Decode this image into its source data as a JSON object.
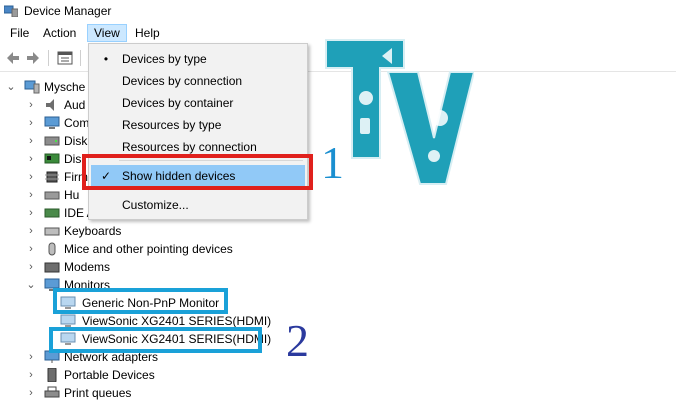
{
  "window": {
    "title": "Device Manager"
  },
  "menu": {
    "file": "File",
    "action": "Action",
    "view": "View",
    "help": "Help"
  },
  "view_menu": {
    "items": [
      {
        "label": "Devices by type",
        "mark": "•"
      },
      {
        "label": "Devices by connection",
        "mark": ""
      },
      {
        "label": "Devices by container",
        "mark": ""
      },
      {
        "label": "Resources by type",
        "mark": ""
      },
      {
        "label": "Resources by connection",
        "mark": ""
      },
      {
        "label": "Show hidden devices",
        "mark": "✓"
      },
      {
        "label": "Customize...",
        "mark": ""
      }
    ]
  },
  "tree": {
    "root": "Mysche",
    "rows": [
      {
        "label": "Aud",
        "icon": "speaker-icon"
      },
      {
        "label": "Com",
        "icon": "computer-icon"
      },
      {
        "label": "Disk",
        "icon": "disk-drive-icon"
      },
      {
        "label": "Dis",
        "icon": "display-adapter-icon"
      },
      {
        "label": "Firm",
        "icon": "firmware-icon"
      },
      {
        "label": "Hu",
        "icon": "hid-icon"
      },
      {
        "label": "IDE A",
        "icon": "ide-controller-icon"
      },
      {
        "label": "Keyboards",
        "icon": "keyboard-icon"
      },
      {
        "label": "Mice and other pointing devices",
        "icon": "mouse-icon"
      },
      {
        "label": "Modems",
        "icon": "modem-icon"
      },
      {
        "label": "Monitors",
        "icon": "monitor-icon"
      },
      {
        "label": "Generic Non-PnP Monitor",
        "icon": "monitor-icon"
      },
      {
        "label": "ViewSonic XG2401 SERIES(HDMI)",
        "icon": "monitor-icon"
      },
      {
        "label": "ViewSonic XG2401 SERIES(HDMI)",
        "icon": "monitor-icon"
      },
      {
        "label": "Network adapters",
        "icon": "network-icon"
      },
      {
        "label": "Portable Devices",
        "icon": "portable-device-icon"
      },
      {
        "label": "Print queues",
        "icon": "printer-icon"
      }
    ]
  },
  "annotations": {
    "callout_1": "1",
    "callout_2": "2"
  },
  "logo": {
    "text": "TV"
  },
  "colors": {
    "menu_highlight": "#91c9f7",
    "red_box": "#e0201c",
    "blue_box": "#1aa1d8",
    "callout_1": "#1a8fd0",
    "callout_2": "#2b3a9e",
    "logo_teal": "#1fa0b8"
  }
}
